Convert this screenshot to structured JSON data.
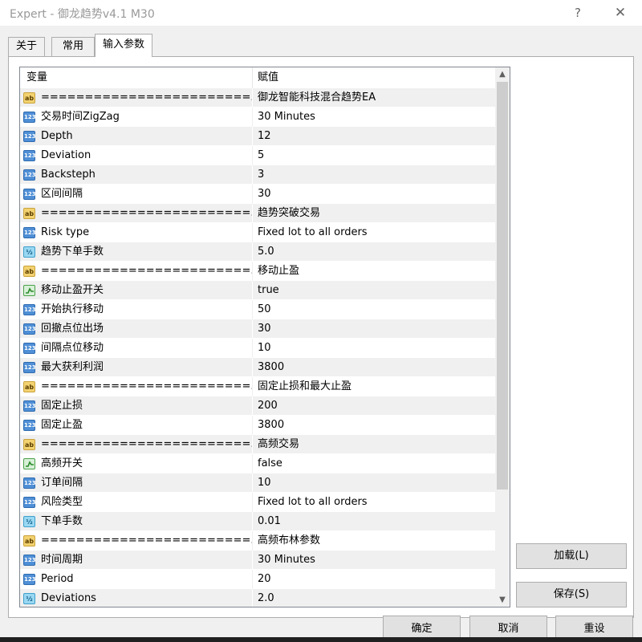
{
  "window": {
    "title": "Expert - 御龙趋势v4.1 M30",
    "help": "?",
    "close": "✕"
  },
  "tabs": [
    {
      "label": "关于"
    },
    {
      "label": "常用"
    },
    {
      "label": "输入参数"
    }
  ],
  "grid": {
    "columns": [
      "变量",
      "赋值"
    ],
    "rows": [
      {
        "type": "string",
        "icon": "ab",
        "name": "========================...",
        "value": "御龙智能科技混合趋势EA"
      },
      {
        "type": "int",
        "icon": "123",
        "name": "交易时间ZigZag",
        "value": "30 Minutes"
      },
      {
        "type": "int",
        "icon": "123",
        "name": "Depth",
        "value": "12"
      },
      {
        "type": "int",
        "icon": "123",
        "name": "Deviation",
        "value": "5"
      },
      {
        "type": "int",
        "icon": "123",
        "name": "Backsteph",
        "value": "3"
      },
      {
        "type": "int",
        "icon": "123",
        "name": "区间间隔",
        "value": "30"
      },
      {
        "type": "string",
        "icon": "ab",
        "name": "========================...",
        "value": "趋势突破交易"
      },
      {
        "type": "int",
        "icon": "123",
        "name": "Risk type",
        "value": "Fixed lot to all orders"
      },
      {
        "type": "double",
        "icon": "½",
        "name": "趋势下单手数",
        "value": "5.0"
      },
      {
        "type": "string",
        "icon": "ab",
        "name": "========================...",
        "value": "移动止盈"
      },
      {
        "type": "bool",
        "icon": "",
        "name": "移动止盈开关",
        "value": "true"
      },
      {
        "type": "int",
        "icon": "123",
        "name": "开始执行移动",
        "value": "50"
      },
      {
        "type": "int",
        "icon": "123",
        "name": "回撤点位出场",
        "value": "30"
      },
      {
        "type": "int",
        "icon": "123",
        "name": "间隔点位移动",
        "value": "10"
      },
      {
        "type": "int",
        "icon": "123",
        "name": "最大获利利润",
        "value": "3800"
      },
      {
        "type": "string",
        "icon": "ab",
        "name": "========================...",
        "value": "固定止损和最大止盈"
      },
      {
        "type": "int",
        "icon": "123",
        "name": "固定止损",
        "value": "200"
      },
      {
        "type": "int",
        "icon": "123",
        "name": "固定止盈",
        "value": "3800"
      },
      {
        "type": "string",
        "icon": "ab",
        "name": "========================...",
        "value": "高频交易"
      },
      {
        "type": "bool",
        "icon": "",
        "name": "高频开关",
        "value": "false"
      },
      {
        "type": "int",
        "icon": "123",
        "name": "订单间隔",
        "value": "10"
      },
      {
        "type": "int",
        "icon": "123",
        "name": "风险类型",
        "value": "Fixed lot to all orders"
      },
      {
        "type": "double",
        "icon": "½",
        "name": "下单手数",
        "value": "0.01"
      },
      {
        "type": "string",
        "icon": "ab",
        "name": "========================...",
        "value": "高频布林参数"
      },
      {
        "type": "int",
        "icon": "123",
        "name": "时间周期",
        "value": "30 Minutes"
      },
      {
        "type": "int",
        "icon": "123",
        "name": "Period",
        "value": "20"
      },
      {
        "type": "double",
        "icon": "½",
        "name": "Deviations",
        "value": "2.0"
      }
    ]
  },
  "buttons": {
    "load": "加载(L)",
    "save": "保存(S)",
    "ok": "确定",
    "cancel": "取消",
    "reset": "重设"
  },
  "scrollbar": {
    "up": "▲",
    "down": "▼",
    "position": 0.0
  }
}
